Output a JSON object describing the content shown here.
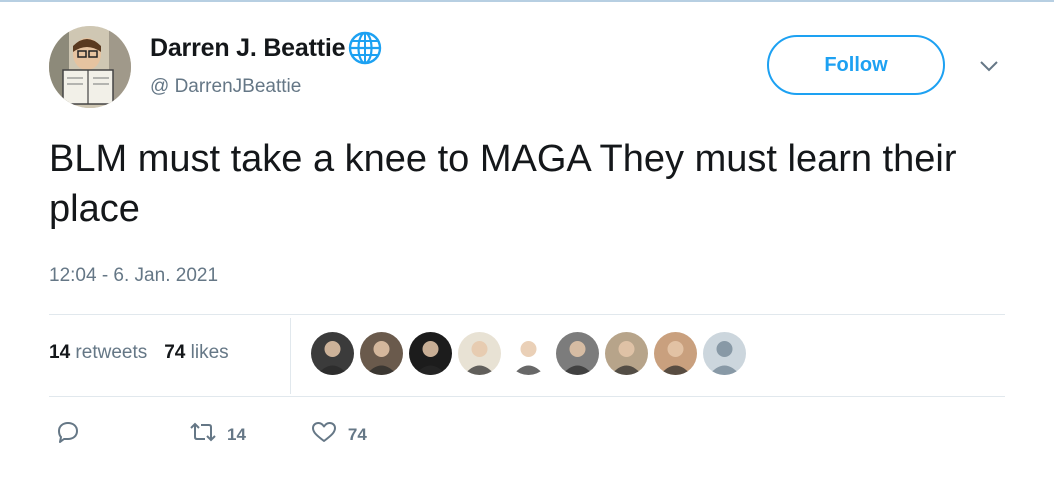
{
  "tweet": {
    "author": {
      "display_name": "Darren J. Beattie",
      "handle": "@ DarrenJBeattie",
      "badge_icon": "globe-icon",
      "avatar_icon": "cartoon-reading-man-avatar"
    },
    "follow_label": "Follow",
    "text": "BLM must take a knee to MAGA They must learn their place",
    "timestamp": "12:04 - 6. Jan. 2021",
    "stats": {
      "retweets_count": "14",
      "retweets_label": "retweets",
      "likes_count": "74",
      "likes_label": "likes"
    },
    "likers": [
      {
        "name": "liker-avatar-1",
        "bg": "#3b3b3b"
      },
      {
        "name": "liker-avatar-2",
        "bg": "#6a5a4c"
      },
      {
        "name": "liker-avatar-3",
        "bg": "#1c1c1c"
      },
      {
        "name": "liker-avatar-4",
        "bg": "#e8e2d4"
      },
      {
        "name": "liker-avatar-5",
        "bg": "#ffffff"
      },
      {
        "name": "liker-avatar-6",
        "bg": "#7c7c7c"
      },
      {
        "name": "liker-avatar-7",
        "bg": "#b7a48a"
      },
      {
        "name": "liker-avatar-8",
        "bg": "#c9a07e"
      },
      {
        "name": "liker-avatar-9",
        "bg": "#ccd6dd"
      }
    ],
    "actions": {
      "reply_icon": "reply-icon",
      "retweet_icon": "retweet-icon",
      "retweet_count": "14",
      "like_icon": "heart-icon",
      "like_count": "74"
    }
  },
  "colors": {
    "accent": "#1da1f2",
    "text_primary": "#14171a",
    "text_secondary": "#657786",
    "divider": "#e1e8ed"
  }
}
